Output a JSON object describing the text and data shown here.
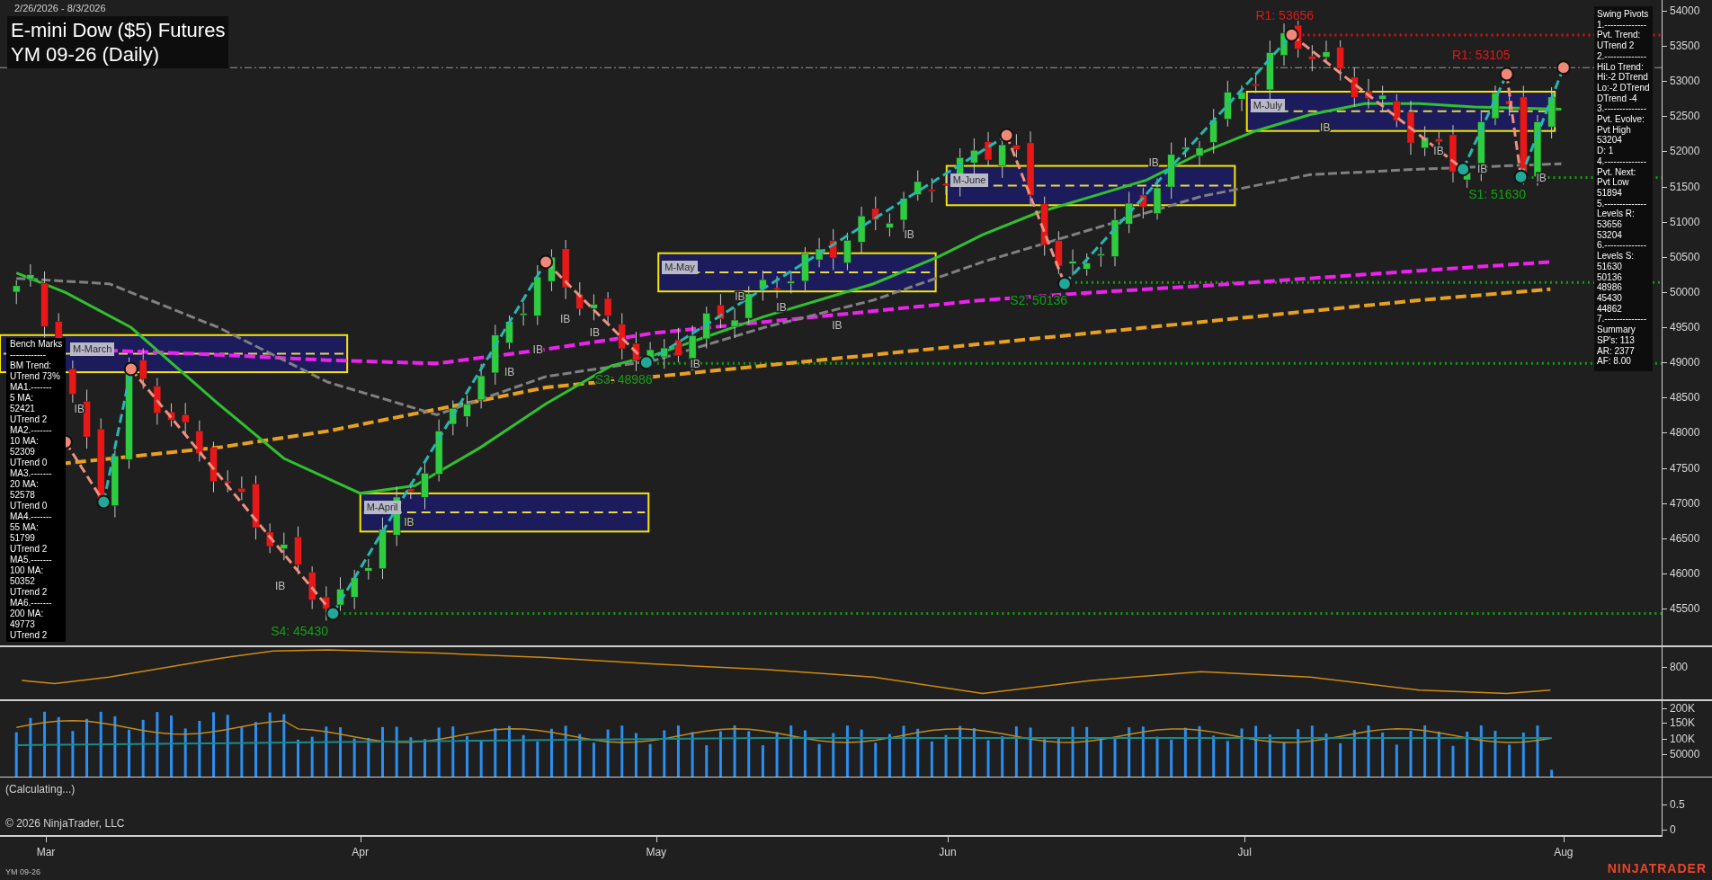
{
  "date_range": "2/26/2026 - 8/3/2026",
  "title": {
    "line_1": "E-mini Dow ($5) Futures",
    "line_2": "YM 09-26 (Daily)"
  },
  "swing_pivots_panel": [
    "Swing Pivots",
    "1.--------------",
    "Pvt. Trend:",
    "UTrend 2",
    "2.--------------",
    "HiLo Trend:",
    "Hi:-2 DTrend",
    "Lo:-2 DTrend",
    "DTrend -4",
    "3.--------------",
    "Pvt. Evolve:",
    "Pvt High",
    "53204",
    "D: 1",
    "4.--------------",
    "Pvt. Next:",
    "Pvt Low",
    "51894",
    "5.--------------",
    "Levels R:",
    "53656",
    "53204",
    "6.--------------",
    "Levels S:",
    "51630",
    "50136",
    "48986",
    "45430",
    "44862",
    "7.--------------",
    "Summary",
    "SP's: 113",
    "AR: 2377",
    "AF: 8.00"
  ],
  "bench_marks_panel": [
    "Bench Marks",
    "------------",
    "BM Trend:",
    "UTrend 73%",
    "MA1.-------",
    "5 MA:",
    "52421",
    "UTrend 2",
    "MA2.-------",
    "10 MA:",
    "52309",
    "UTrend 0",
    "MA3.-------",
    "20 MA:",
    "52578",
    "UTrend 0",
    "MA4.-------",
    "55 MA:",
    "51799",
    "UTrend 2",
    "MA5.-------",
    "100 MA:",
    "50352",
    "UTrend 2",
    "MA6.-------",
    "200 MA:",
    "49773",
    "UTrend 2"
  ],
  "pivot_labels": [
    {
      "text": "R1: 53656",
      "kind": "resistance"
    },
    {
      "text": "R1: 53105",
      "kind": "resistance"
    },
    {
      "text": "S1: 51630",
      "kind": "support"
    },
    {
      "text": "S2: 50136",
      "kind": "support"
    },
    {
      "text": "S3: 48986",
      "kind": "support"
    },
    {
      "text": "S4: 45430",
      "kind": "support"
    }
  ],
  "range_boxes": [
    "M-March",
    "M-April",
    "M-May",
    "M-June",
    "M-July"
  ],
  "ib_marks": [
    "IB",
    "IB",
    "IB",
    "IB",
    "IB",
    "IB",
    "IB",
    "IB",
    "IB",
    "IB",
    "IB",
    "IB",
    "IB",
    "IB",
    "IB",
    "IB",
    "IB"
  ],
  "price_axis": [
    "54000",
    "53500",
    "53000",
    "52500",
    "52000",
    "51500",
    "51000",
    "50500",
    "50000",
    "49500",
    "49000",
    "48500",
    "48000",
    "47500",
    "47000",
    "46500",
    "46000",
    "45500"
  ],
  "indicator_axis": [
    "800"
  ],
  "volume_axis": [
    "200K",
    "150K",
    "100K",
    "50000"
  ],
  "lower_axis": [
    "0.5",
    "0"
  ],
  "status_text": "(Calculating...)",
  "copyright": "© 2026 NinjaTrader, LLC",
  "time_axis": [
    "Mar",
    "Apr",
    "May",
    "Jun",
    "Jul",
    "Aug"
  ],
  "instrument_footer": "YM 09-26",
  "logo": "NINJATRADER"
}
